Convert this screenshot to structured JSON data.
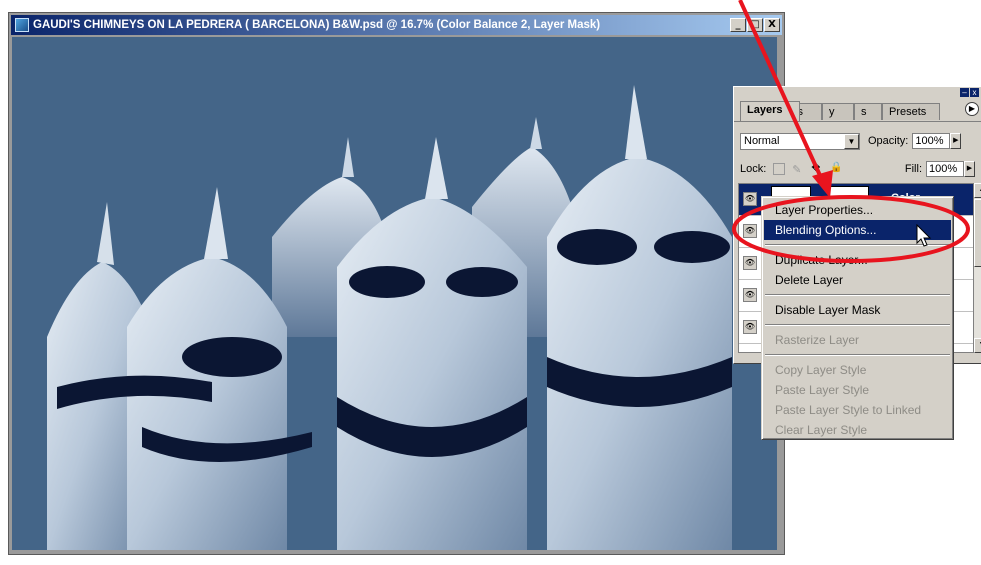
{
  "document": {
    "title": "GAUDI'S CHIMNEYS ON LA PEDRERA ( BARCELONA) B&W.psd @ 16.7% (Color Balance 2, Layer Mask)",
    "window_buttons": [
      "_",
      "□",
      "X"
    ]
  },
  "palette": {
    "tabs": [
      "Layers",
      "els",
      "y",
      "s",
      "Presets"
    ],
    "blend_mode": "Normal",
    "opacity_label": "Opacity:",
    "opacity_value": "100%",
    "lock_label": "Lock:",
    "fill_label": "Fill:",
    "fill_value": "100%",
    "selected_layer_name": "Color"
  },
  "context_menu": {
    "items": [
      {
        "label": "Layer Properties...",
        "state": "normal"
      },
      {
        "label": "Blending Options...",
        "state": "highlighted"
      },
      {
        "label": "Duplicate Layer...",
        "state": "normal"
      },
      {
        "label": "Delete Layer",
        "state": "normal"
      },
      {
        "label": "Disable Layer Mask",
        "state": "normal"
      },
      {
        "label": "Rasterize Layer",
        "state": "disabled"
      },
      {
        "label": "Copy Layer Style",
        "state": "disabled"
      },
      {
        "label": "Paste Layer Style",
        "state": "disabled"
      },
      {
        "label": "Paste Layer Style to Linked",
        "state": "disabled"
      },
      {
        "label": "Clear Layer Style",
        "state": "disabled"
      }
    ]
  },
  "colors": {
    "title_bar": "#0a246a",
    "highlight": "#0a246a",
    "annotation": "#e8141e",
    "photo_background": "#446588"
  },
  "icons": [
    "document-icon",
    "minimize-icon",
    "maximize-icon",
    "close-icon",
    "palette-menu-icon",
    "eye-icon",
    "lock-icon",
    "move-icon",
    "arrow-cursor-icon"
  ]
}
